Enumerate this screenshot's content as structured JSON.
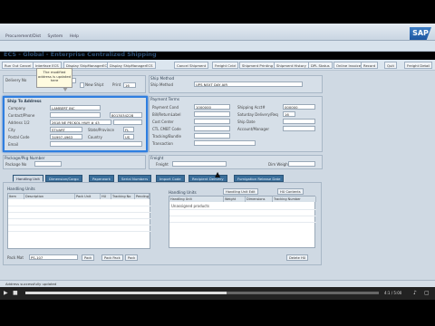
{
  "menu": [
    "Procurement/Dist",
    "System",
    "Help"
  ],
  "app_title": "ECS - Global - Enterprise Centralized Shipping",
  "toolbar": [
    "Run Out Cancel",
    "Interface ECS",
    "Display ShipManagerECS",
    "Cancel Shipment",
    "Freight Cntrl",
    "Shipment Printing",
    "Shipment History",
    "Prod Cost",
    "Freight Details",
    "DPL Status",
    "Online Invoice",
    "Record",
    "Quit",
    "Freight Detail"
  ],
  "callout": "The modified address is updated here",
  "header_fields": {
    "shipment_no_label": "Delivery No",
    "new_ship_label": "New Shipt",
    "print_label": "Print",
    "print_value": "16",
    "ship_method_title": "Ship Method",
    "ship_method_label": "Ship Method",
    "ship_method_value": "UPS NEXT DAY AIR"
  },
  "ship_to": {
    "title": "Ship To Address",
    "company_label": "Company",
    "company_value": "LAMBERT INC",
    "contact_label": "Contact/Phone",
    "contact_value": "",
    "phone_value": "8013034228",
    "addr_label": "Address 1/2",
    "addr_value": "2618 NE PECKOL HWY # 43",
    "city_label": "City",
    "city_value": "STUART",
    "state_label": "State/Province",
    "state_value": "FL",
    "postal_label": "Postal Code",
    "postal_value": "34997-4963",
    "country_label": "Country",
    "country_value": "US",
    "email_label": "Email",
    "email_value": ""
  },
  "payment": {
    "title": "Payment Terms",
    "rows_left": [
      {
        "label": "Payment Cond",
        "value": "1000000"
      },
      {
        "label": "Bill/ReturnLabel",
        "value": ""
      },
      {
        "label": "Cost Center",
        "value": ""
      },
      {
        "label": "CTL CMBT Code",
        "value": ""
      },
      {
        "label": "Tracking/Bundle",
        "value": ""
      },
      {
        "label": "Transaction",
        "value": ""
      }
    ],
    "rows_right": [
      {
        "label": "Shipping Acct#",
        "value": "000000"
      },
      {
        "label": "Saturday Delivery/Req",
        "value": "16"
      },
      {
        "label": "Ship Date",
        "value": ""
      },
      {
        "label": "Account/Manager",
        "value": ""
      }
    ]
  },
  "package": {
    "title": "Package/Pkg Number",
    "label": "Package No"
  },
  "freight": {
    "title": "Freight",
    "freight_label": "Freight",
    "dimweight_label": "Dim Weight"
  },
  "tabs": [
    "Handling Unit",
    "Dimension/Cargo",
    "Paperwork",
    "Serial Numbers",
    "Import Code",
    "Recipient Delivery",
    "Fumigation Release Date"
  ],
  "left_table": {
    "title": "Handling Units",
    "cols": [
      "Item",
      "Description",
      "Pack Unit",
      "HU",
      "Tracking No",
      "Pending"
    ],
    "pack_label": "Pack Mat",
    "pack_value": "PS-107",
    "buttons": [
      "Pack",
      "Pack Pack",
      "Pack",
      "Delete HU"
    ]
  },
  "right_table": {
    "title": "Handling Units",
    "top_buttons": [
      "Handling Unit Edit",
      "HU Contents"
    ],
    "cols": [
      "Handling Unit",
      "Weight",
      "Dimensions",
      "Tracking Number"
    ],
    "first_row": "Unassigned products",
    "buttons": [
      "Delete HU"
    ]
  },
  "status": "Address successfully updated",
  "player": {
    "time": "4:1 / 5:00"
  }
}
